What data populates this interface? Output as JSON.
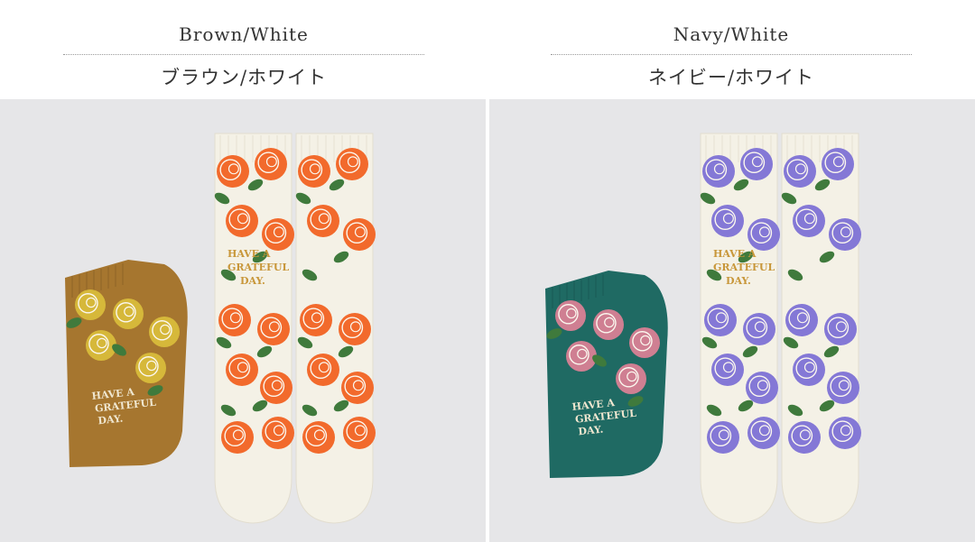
{
  "variants": [
    {
      "name_en": "Brown/White",
      "name_ja": "ブラウン/ホワイト",
      "folded_sock_color": "#a6762f",
      "folded_rose_color": "#d6b83a",
      "rose_color": "#f26a2c",
      "text_color": "#c8973a",
      "sock_text": [
        "HAVE A",
        "GRATEFUL",
        "DAY."
      ]
    },
    {
      "name_en": "Navy/White",
      "name_ja": "ネイビー/ホワイト",
      "folded_sock_color": "#1f6a63",
      "folded_rose_color": "#cf7f92",
      "rose_color": "#8478d6",
      "text_color": "#c8973a",
      "sock_text": [
        "HAVE A",
        "GRATEFUL",
        "DAY."
      ]
    }
  ]
}
